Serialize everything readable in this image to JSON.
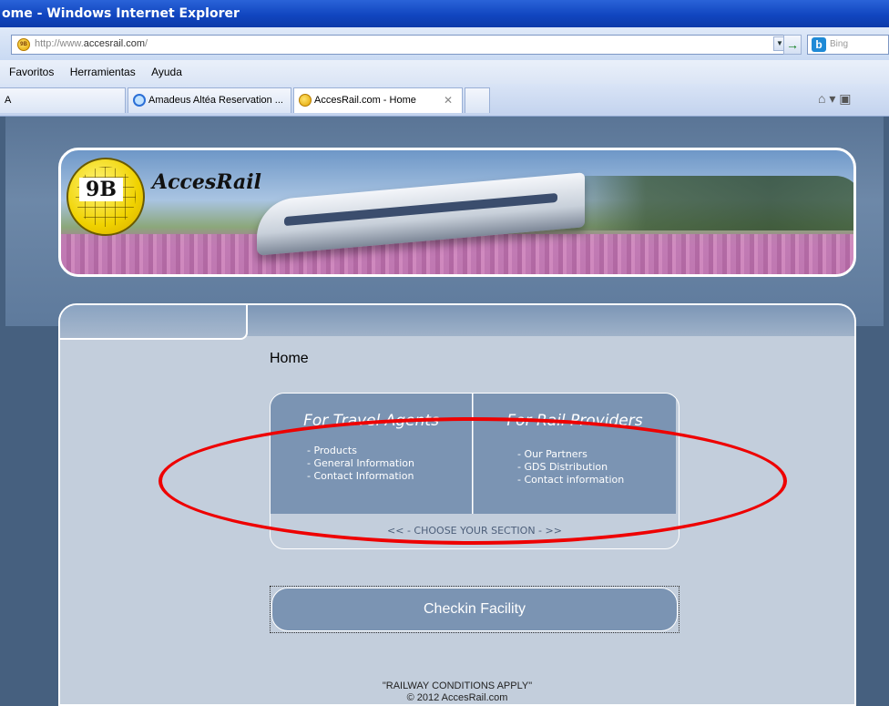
{
  "browser": {
    "title": "ome - Windows Internet Explorer",
    "address": {
      "prefix": "http://www.",
      "domain": "accesrail.com",
      "suffix": "/"
    },
    "search_placeholder": "Bing",
    "menu": [
      "Favoritos",
      "Herramientas",
      "Ayuda"
    ],
    "tabs": [
      {
        "label": "A"
      },
      {
        "label": "Amadeus Altéa Reservation ..."
      },
      {
        "label": "AccesRail.com - Home",
        "active": true
      }
    ]
  },
  "site": {
    "logo_mark": "9B",
    "logo_name": "AccesRail",
    "page_title": "Home",
    "sections": [
      {
        "title": "For Travel Agents",
        "links": [
          "- Products",
          "- General Information",
          "- Contact Information"
        ]
      },
      {
        "title": "For Rail Providers",
        "links": [
          "- Our Partners",
          "- GDS Distribution",
          "- Contact information"
        ]
      }
    ],
    "choose_label": "<<  -  CHOOSE YOUR SECTION  -  >>",
    "checkin_label": "Checkin Facility",
    "footer_line1": "\"RAILWAY CONDITIONS APPLY\"",
    "footer_line2": "© 2012 AccesRail.com"
  },
  "colors": {
    "accent_panel": "#7b94b3",
    "highlight": "#e00000"
  }
}
